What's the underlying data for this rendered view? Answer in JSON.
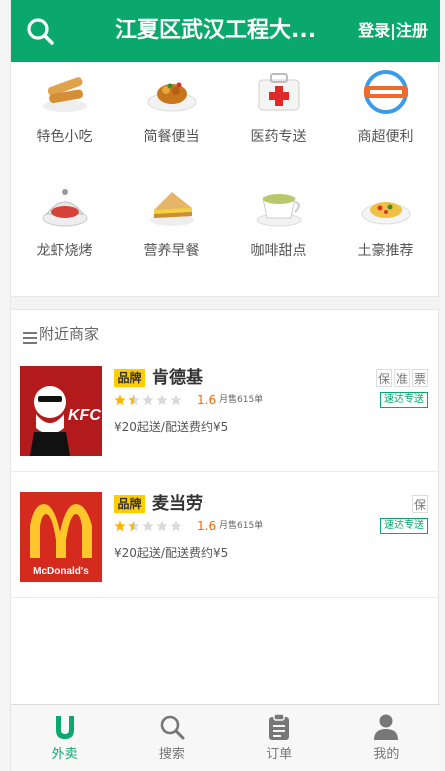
{
  "header": {
    "title": "江夏区武汉工程大...",
    "login_label": "登录",
    "divider": "|",
    "register_label": "注册"
  },
  "categories": [
    {
      "label": "特色小吃",
      "icon": "spring-roll-icon"
    },
    {
      "label": "简餐便当",
      "icon": "bento-icon"
    },
    {
      "label": "医药专送",
      "icon": "medicine-box-icon"
    },
    {
      "label": "商超便利",
      "icon": "supermarket-delivery-icon"
    },
    {
      "label": "龙虾烧烤",
      "icon": "lobster-icon"
    },
    {
      "label": "营养早餐",
      "icon": "sandwich-icon"
    },
    {
      "label": "咖啡甜点",
      "icon": "coffee-icon"
    },
    {
      "label": "土豪推荐",
      "icon": "pasta-icon"
    }
  ],
  "nearby": {
    "title": "附近商家"
  },
  "shops": [
    {
      "badge": "品牌",
      "name": "肯德基",
      "tags": [
        "保",
        "准",
        "票"
      ],
      "rating": 1.6,
      "rating_text": "1.6",
      "sales": "月售615单",
      "delivery": "速达专送",
      "meta": "¥20起送/配送费约¥5",
      "logo_text": "KFC"
    },
    {
      "badge": "品牌",
      "name": "麦当劳",
      "tags": [
        "保"
      ],
      "rating": 1.6,
      "rating_text": "1.6",
      "sales": "月售615单",
      "delivery": "速达专送",
      "meta": "¥20起送/配送费约¥5",
      "logo_text": "McDonald's"
    }
  ],
  "tabs": [
    {
      "label": "外卖",
      "icon": "takeout-icon",
      "active": true
    },
    {
      "label": "搜索",
      "icon": "search-icon",
      "active": false
    },
    {
      "label": "订单",
      "icon": "order-icon",
      "active": false
    },
    {
      "label": "我的",
      "icon": "user-icon",
      "active": false
    }
  ],
  "colors": {
    "brand_green": "#0aa86c",
    "badge_yellow": "#ffcc00",
    "rating_orange": "#ff6600"
  }
}
